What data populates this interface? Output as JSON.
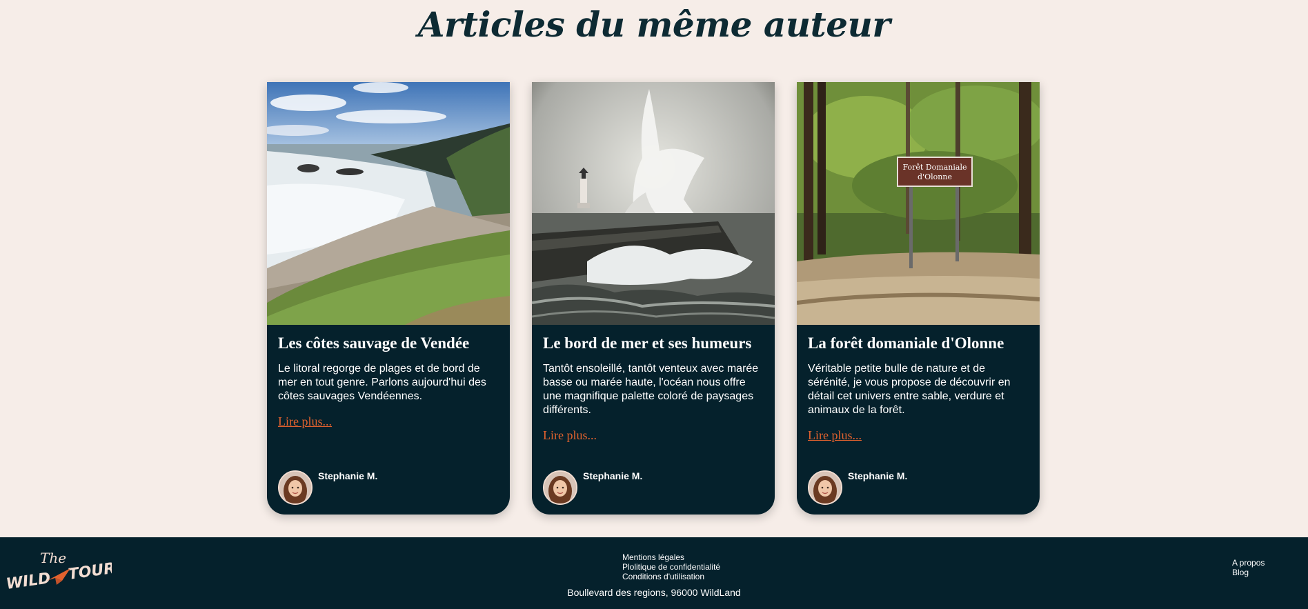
{
  "section": {
    "title": "Articles du même auteur"
  },
  "cards": [
    {
      "image_icon": "coastal-cliff-photo",
      "title": "Les côtes sauvage de Vendée",
      "text": "Le litoral regorge de plages et de bord de mer en tout genre. Parlons aujourd'hui des côtes sauvages Vendéennes.",
      "link": "Lire plus...",
      "author": "Stephanie M."
    },
    {
      "image_icon": "lighthouse-storm-photo",
      "title": "Le bord de mer et ses humeurs",
      "text": "Tantôt ensoleillé, tantôt venteux avec marée basse ou marée haute, l'océan nous offre une magnifique palette coloré de paysages différents.",
      "link": "Lire plus...",
      "author": "Stephanie M."
    },
    {
      "image_icon": "forest-sign-photo",
      "title": "La forêt domaniale d'Olonne",
      "text": "Véritable petite bulle de nature et de sérénité, je vous propose de découvrir en détail cet univers entre sable, verdure et animaux de la forêt.",
      "link": "Lire plus...",
      "author": "Stephanie M."
    }
  ],
  "photo3_sign": {
    "line1": "Forêt Domaniale",
    "line2": "d'Olonne"
  },
  "footer": {
    "logo_the": "The",
    "logo_wild": "WILD",
    "logo_tour": "TOUR",
    "legal_links": [
      "Mentions légales",
      "Plolitique de confidentialité",
      "Conditions d'utilisation"
    ],
    "address": "Boullevard des regions, 96000 WildLand",
    "side_links": [
      "A propos",
      "Blog"
    ]
  },
  "colors": {
    "background": "#f6ede8",
    "card": "#05212c",
    "accent": "#e2622e",
    "title": "#0d2a33"
  }
}
